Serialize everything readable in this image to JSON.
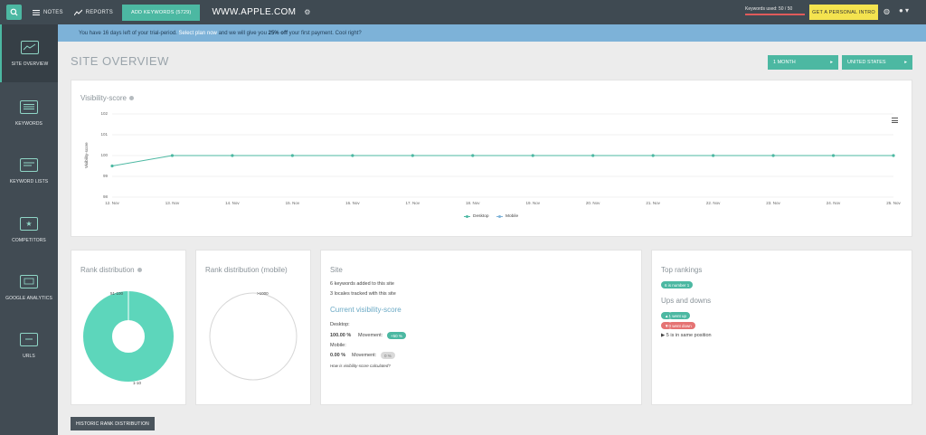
{
  "topbar": {
    "notes_label": "NOTES",
    "reports_label": "REPORTS",
    "add_keywords_label": "ADD KEYWORDS (5729)",
    "domain": "WWW.APPLE.COM",
    "keywords_used": "Keywords used: 50 / 50",
    "intro_label": "GET A PERSONAL INTRO"
  },
  "sidebar": {
    "items": [
      {
        "label": "SITE OVERVIEW",
        "icon": "chart-screen-icon"
      },
      {
        "label": "KEYWORDS",
        "icon": "keyword-list-icon"
      },
      {
        "label": "KEYWORD LISTS",
        "icon": "list-screen-icon"
      },
      {
        "label": "COMPETITORS",
        "icon": "star-screen-icon"
      },
      {
        "label": "GOOGLE ANALYTICS",
        "icon": "analytics-laptop-icon"
      },
      {
        "label": "URLS",
        "icon": "url-screen-icon"
      }
    ]
  },
  "banner": {
    "text_before": "You have 16 days left of your trial-period. ",
    "link": "Select plan now",
    "text_middle": " and we will give you ",
    "bold": "25% off",
    "text_after": " your first payment. Cool right?"
  },
  "page": {
    "title": "SITE OVERVIEW",
    "period_label": "1 MONTH",
    "country_label": "UNITED STATES"
  },
  "visibility": {
    "title": "Visibility-score",
    "ylabel": "Visibility-score",
    "legend": [
      "Desktop",
      "Mobile"
    ]
  },
  "chart_data": {
    "type": "line",
    "title": "Visibility-score",
    "ylabel": "Visibility-score",
    "xlabel": "",
    "y_ticks": [
      "102",
      "101",
      "100",
      "99",
      "98"
    ],
    "x": [
      "12. Nov",
      "13. Nov",
      "14. Nov",
      "15. Nov",
      "16. Nov",
      "17. Nov",
      "18. Nov",
      "19. Nov",
      "20. Nov",
      "21. Nov",
      "22. Nov",
      "23. Nov",
      "24. Nov",
      "25. Nov"
    ],
    "series": [
      {
        "name": "Desktop",
        "color": "#4cb8a2",
        "values": [
          99.5,
          100,
          100,
          100,
          100,
          100,
          100,
          100,
          100,
          100,
          100,
          100,
          100,
          100
        ]
      },
      {
        "name": "Mobile",
        "color": "#7db2d8",
        "values": []
      }
    ],
    "legend": "bottom-center",
    "grid": true
  },
  "rank_distribution": {
    "title": "Rank distribution",
    "label_top": "51-100",
    "label_bottom": "1-10",
    "desktop_share_1_10": 0.97,
    "desktop_share_51_100": 0.03
  },
  "rank_distribution_mobile": {
    "title": "Rank distribution (mobile)",
    "label": ">1000"
  },
  "site": {
    "title": "Site",
    "keywords_added": "6 keywords added to this site",
    "locales": "3 locales tracked with this site",
    "current_title": "Current visibility-score",
    "desktop_label": "Desktop:",
    "desktop_value": "100.00 %",
    "movement_label": "Movement:",
    "desktop_movement": "+50 %",
    "mobile_label": "Mobile:",
    "mobile_value": "0.00 %",
    "mobile_movement": "0 %",
    "help_link": "How is visibility-score calculated?"
  },
  "top_rankings": {
    "title": "Top rankings",
    "number_one_badge": "6 is number 1",
    "ups_title": "Ups and downs",
    "went_up_badge": "1 went up",
    "went_down_badge": "0 went down",
    "same_position": "5 is in same position"
  },
  "footer": {
    "historic_button": "HISTORIC RANK DISTRIBUTION"
  }
}
